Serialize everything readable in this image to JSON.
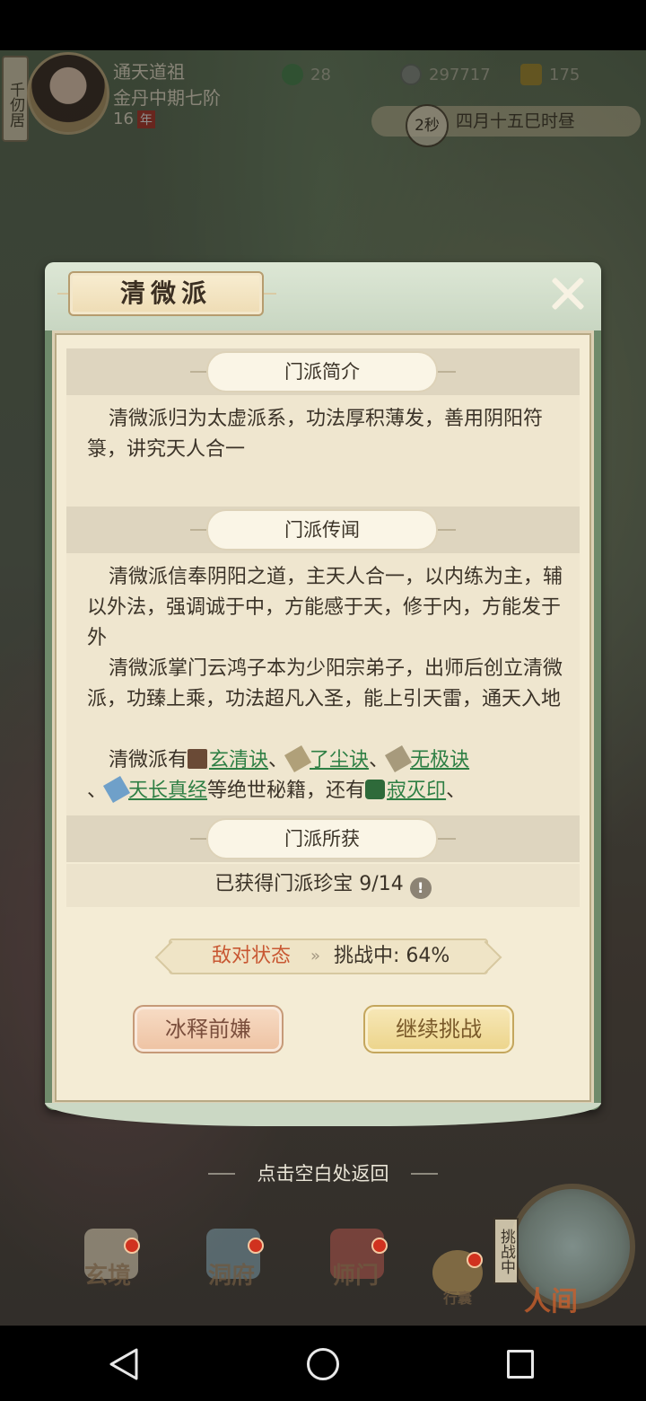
{
  "hud": {
    "side_tab": "千仞居",
    "player_name": "通天道祖",
    "realm": "金丹中期七阶",
    "age": "16",
    "age_unit": "年",
    "jade": "28",
    "coins": "297717",
    "strength": "175",
    "time_circle": "2秒",
    "date_text": "四月十五巳时昼"
  },
  "dialog": {
    "title": "清微派",
    "sections": {
      "intro": {
        "label": "门派简介",
        "text": "清微派归为太虚派系，功法厚积薄发，善用阴阳符箓，讲究天人合一"
      },
      "legend": {
        "label": "门派传闻",
        "p1": "清微派信奉阴阳之道，主天人合一，以内练为主，辅以外法，强调诚于中，方能感于天，修于内，方能发于外",
        "p2": "清微派掌门云鸿子本为少阳宗弟子，出师后创立清微派，功臻上乘，功法超凡入圣，能上引天雷，通天入地",
        "p3_prefix": "清微派有",
        "sep": "、",
        "books": [
          "玄清诀",
          "了尘诀",
          "无极诀",
          "天长真经"
        ],
        "p3_mid": "等绝世秘籍，还有",
        "seal": "寂灭印"
      },
      "gains": {
        "label": "门派所获",
        "treasure_text": "已获得门派珍宝 9/14",
        "info_icon": "!"
      }
    },
    "status": {
      "hostile": "敌对状态",
      "arrow": "»",
      "challenge": "挑战中: 64%"
    },
    "buttons": {
      "reconcile": "冰释前嫌",
      "continue": "继续挑战"
    }
  },
  "hint": "点击空白处返回",
  "bottom_nav": {
    "items": [
      "玄境",
      "洞府",
      "师门",
      "行囊"
    ],
    "world_tag": "挑战中",
    "world_label": "人间"
  },
  "colors": {
    "link": "#2e7f44",
    "hostile": "#c85732",
    "dialog_green": "#6f8a6b",
    "panel_bg": "#f4ecd5"
  }
}
